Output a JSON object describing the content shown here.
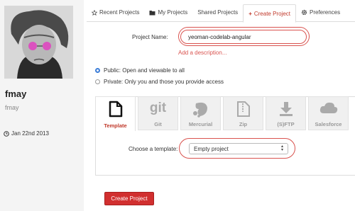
{
  "user": {
    "name": "fmay",
    "handle": "fmay",
    "joined": "Jan 22nd 2013"
  },
  "tabs": [
    {
      "label": "Recent Projects",
      "icon": "star-icon"
    },
    {
      "label": "My Projects",
      "icon": "folder-icon"
    },
    {
      "label": "Shared Projects",
      "icon": ""
    },
    {
      "label": "Create Project",
      "icon": "plus-icon"
    },
    {
      "label": "Preferences",
      "icon": "gear-icon"
    }
  ],
  "form": {
    "project_name_label": "Project Name:",
    "project_name_value": "yeoman-codelab-angular",
    "add_description": "Add a description...",
    "visibility_public": "Public: Open and viewable to all",
    "visibility_private": "Private: Only you and those you provide access",
    "choose_template_label": "Choose a template:",
    "template_selected": "Empty project",
    "create_button": "Create Project"
  },
  "repo_types": [
    {
      "label": "Template",
      "icon": "document-icon"
    },
    {
      "label": "Git",
      "icon": "git-logo-icon"
    },
    {
      "label": "Mercurial",
      "icon": "mercurial-logo-icon"
    },
    {
      "label": "Zip",
      "icon": "zip-file-icon"
    },
    {
      "label": "(S)FTP",
      "icon": "download-arrow-icon"
    },
    {
      "label": "Salesforce",
      "icon": "cloud-icon"
    }
  ],
  "colors": {
    "accent": "#c0392b",
    "button": "#d12f2f",
    "radio": "#3b7dd8"
  }
}
